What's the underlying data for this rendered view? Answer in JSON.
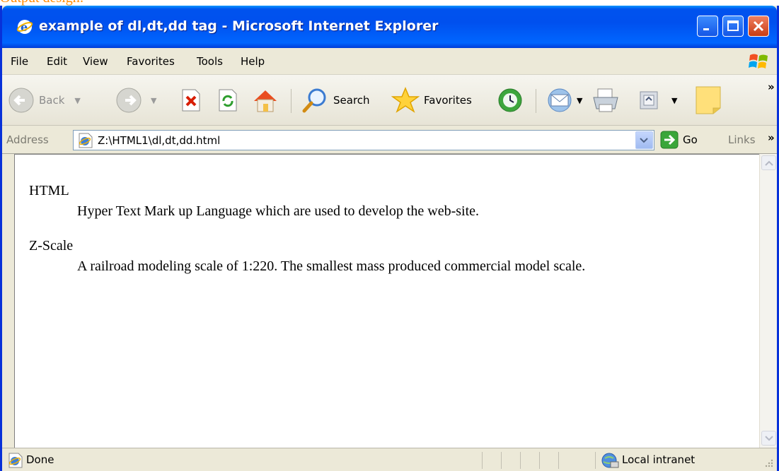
{
  "caption": "Output design:",
  "window": {
    "title": "example of dl,dt,dd tag - Microsoft Internet Explorer",
    "controls": {
      "minimize": "minimize-icon",
      "maximize": "maximize-icon",
      "close": "close-icon"
    }
  },
  "menu": [
    "File",
    "Edit",
    "View",
    "Favorites",
    "Tools",
    "Help"
  ],
  "toolbar": {
    "back_label": "Back",
    "search_label": "Search",
    "favorites_label": "Favorites"
  },
  "address": {
    "label": "Address",
    "value": "Z:\\HTML1\\dl,dt,dd.html",
    "go_label": "Go",
    "links_label": "Links"
  },
  "content": {
    "items": [
      {
        "term": "HTML",
        "definition": "Hyper Text Mark up Language which are used to develop the web-site."
      },
      {
        "term": "Z-Scale",
        "definition": "A railroad modeling scale of 1:220. The smallest mass produced commercial model scale."
      }
    ]
  },
  "status": {
    "text": "Done",
    "zone": "Local intranet"
  },
  "colors": {
    "titlebar": "#0058ee",
    "chrome": "#ece9d8",
    "caption": "#ff8c00"
  }
}
